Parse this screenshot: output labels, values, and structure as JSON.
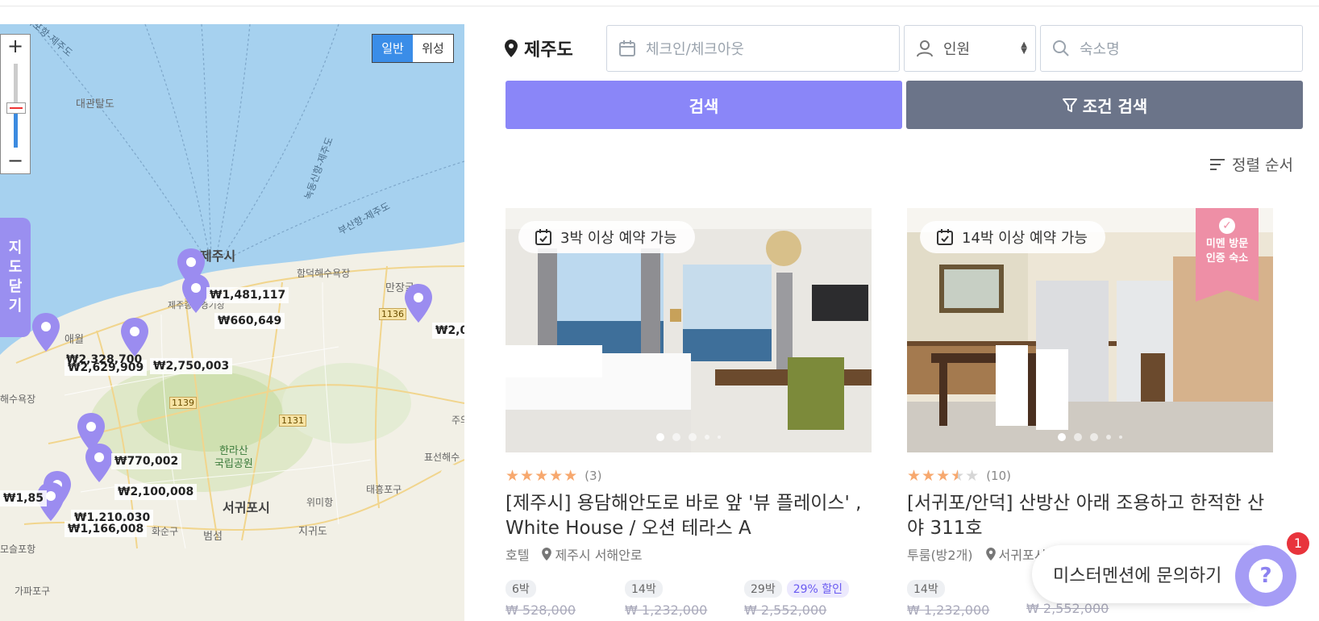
{
  "colors": {
    "accent": "#8a86f8",
    "filter": "#6b7489",
    "map_water": "#a6d1ef",
    "pin": "#9b8cf0"
  },
  "map": {
    "zoom_in": "+",
    "zoom_out": "−",
    "type_normal": "일반",
    "type_satellite": "위성",
    "close_map": [
      "지",
      "도",
      "닫",
      "기"
    ],
    "labels": {
      "daegwantal": "대관탈도",
      "jeju_city": "제주시",
      "hamdeok": "함덕해수욕장",
      "manjang": "만장굴",
      "jeju_stadium": "제주종합경기장",
      "aewol": "애월",
      "haesu": "해수욕장",
      "hallasan": "한라산\n국립공원",
      "seogwipo": "서귀포시",
      "wimi": "위미항",
      "taeheung": "태흥포구",
      "jigwido": "지귀도",
      "beomseom": "범섬",
      "hwasun": "화순구",
      "moseulpo": "모슬포항",
      "gapa": "가파포구",
      "pyoseon": "표선해수",
      "route1": "녹동신항-제주도",
      "route2": "부산항-제주도",
      "route3": "목포항-제주도",
      "jeju_short": "주의"
    },
    "roads": {
      "r1136": "1136",
      "r1139": "1139",
      "r1131": "1131"
    },
    "prices": {
      "p1": "₩1,481,117",
      "p2": "₩660,649",
      "p3": "₩2,0",
      "p4": "₩2,328,700",
      "p5": "₩2,629,909",
      "p6": "₩2,750,003",
      "p7": "₩770,002",
      "p8": "₩2,100,008",
      "p9": "₩1,85",
      "p10": "₩1,210,030",
      "p11": "₩1,166,008"
    }
  },
  "search": {
    "location": "제주도",
    "date_placeholder": "체크인/체크아웃",
    "guests_label": "인원",
    "name_placeholder": "숙소명",
    "search_button": "검색",
    "filter_button": "조건 검색",
    "sort_label": "정렬 순서"
  },
  "listings": [
    {
      "badge": "3박 이상 예약 가능",
      "rating_stars": 5,
      "review_count": "(3)",
      "title": "[제주시] 용담해안도로 바로 앞 '뷰 플레이스' , White House / 오션 테라스 A",
      "type": "호텔",
      "location": "제주시 서해안로",
      "prices": [
        {
          "nights": "6박",
          "original": "₩ 528,000",
          "discount": ""
        },
        {
          "nights": "14박",
          "original": "₩ 1,232,000",
          "discount": ""
        },
        {
          "nights": "29박",
          "original": "₩ 2,552,000",
          "discount": "29% 할인"
        }
      ]
    },
    {
      "badge": "14박 이상 예약 가능",
      "ribbon": "미멘 방문\n인증 숙소",
      "rating_stars": 3.5,
      "review_count": "(10)",
      "title": "[서귀포/안덕] 산방산 아래 조용하고 한적한 산야 311호",
      "type": "투룸(방2개)",
      "location": "서귀포시 안덕면",
      "prices": [
        {
          "nights": "14박",
          "original": "₩ 1,232,000",
          "discount": ""
        },
        {
          "nights": "",
          "original": "₩ 2,552,000",
          "discount": ""
        }
      ]
    }
  ],
  "chat": {
    "label": "미스터멘션에 문의하기",
    "icon": "?",
    "count": "1"
  }
}
